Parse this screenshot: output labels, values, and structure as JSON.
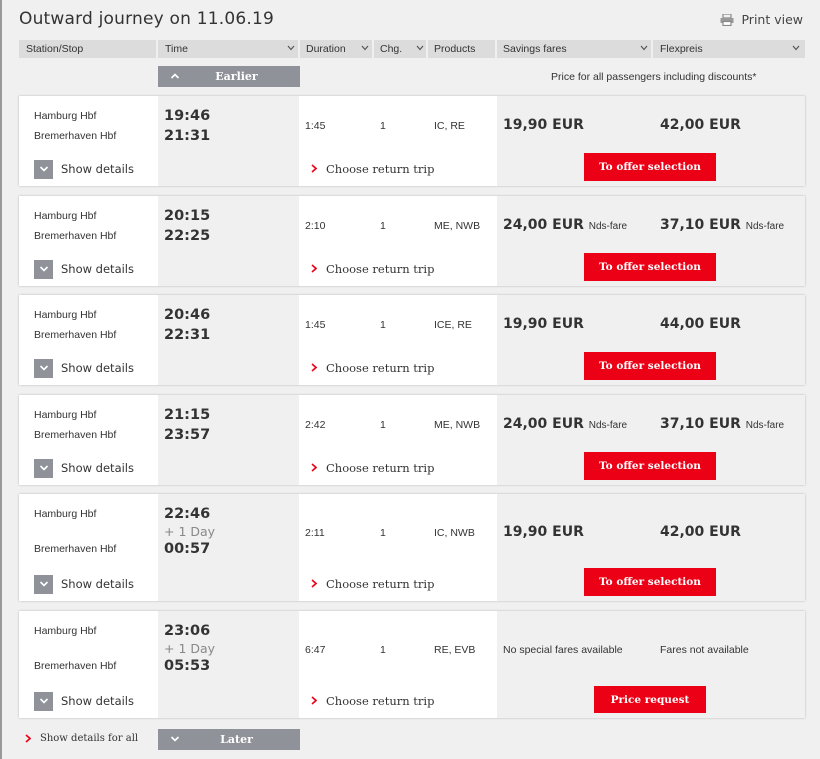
{
  "header": {
    "title": "Outward journey on 11.06.19",
    "print_label": "Print view"
  },
  "columns": {
    "station": "Station/Stop",
    "time": "Time",
    "duration": "Duration",
    "changes": "Chg.",
    "products": "Products",
    "savings": "Savings fares",
    "flex": "Flexpreis"
  },
  "earlier_label": "Earlier",
  "later_label": "Later",
  "price_note": "Price for all passengers including discounts*",
  "show_details_label": "Show details",
  "return_trip_label": "Choose return trip",
  "show_all_label": "Show details for all",
  "colors": {
    "accent": "#ec0016",
    "button_gray": "#8f9399",
    "background": "#f0f0f0"
  },
  "connections": [
    {
      "from": "Hamburg Hbf",
      "to": "Bremerhaven Hbf",
      "dep": "19:46",
      "arr": "21:31",
      "plus_day": "",
      "duration": "1:45",
      "changes": "1",
      "products": "IC, RE",
      "saving": "19,90 EUR",
      "saving_note": "",
      "flex": "42,00 EUR",
      "flex_note": "",
      "button": "To offer selection"
    },
    {
      "from": "Hamburg Hbf",
      "to": "Bremerhaven Hbf",
      "dep": "20:15",
      "arr": "22:25",
      "plus_day": "",
      "duration": "2:10",
      "changes": "1",
      "products": "ME, NWB",
      "saving": "24,00 EUR",
      "saving_note": "Nds-fare",
      "flex": "37,10 EUR",
      "flex_note": "Nds-fare",
      "button": "To offer selection"
    },
    {
      "from": "Hamburg Hbf",
      "to": "Bremerhaven Hbf",
      "dep": "20:46",
      "arr": "22:31",
      "plus_day": "",
      "duration": "1:45",
      "changes": "1",
      "products": "ICE, RE",
      "saving": "19,90 EUR",
      "saving_note": "",
      "flex": "44,00 EUR",
      "flex_note": "",
      "button": "To offer selection"
    },
    {
      "from": "Hamburg Hbf",
      "to": "Bremerhaven Hbf",
      "dep": "21:15",
      "arr": "23:57",
      "plus_day": "",
      "duration": "2:42",
      "changes": "1",
      "products": "ME, NWB",
      "saving": "24,00 EUR",
      "saving_note": "Nds-fare",
      "flex": "37,10 EUR",
      "flex_note": "Nds-fare",
      "button": "To offer selection"
    },
    {
      "from": "Hamburg Hbf",
      "to": "Bremerhaven Hbf",
      "dep": "22:46",
      "arr": "00:57",
      "plus_day": "+ 1 Day",
      "duration": "2:11",
      "changes": "1",
      "products": "IC, NWB",
      "saving": "19,90 EUR",
      "saving_note": "",
      "flex": "42,00 EUR",
      "flex_note": "",
      "button": "To offer selection"
    },
    {
      "from": "Hamburg Hbf",
      "to": "Bremerhaven Hbf",
      "dep": "23:06",
      "arr": "05:53",
      "plus_day": "+ 1 Day",
      "duration": "6:47",
      "changes": "1",
      "products": "RE, EVB",
      "saving_text": "No special fares available",
      "flex_text": "Fares not available",
      "button": "Price request"
    }
  ]
}
